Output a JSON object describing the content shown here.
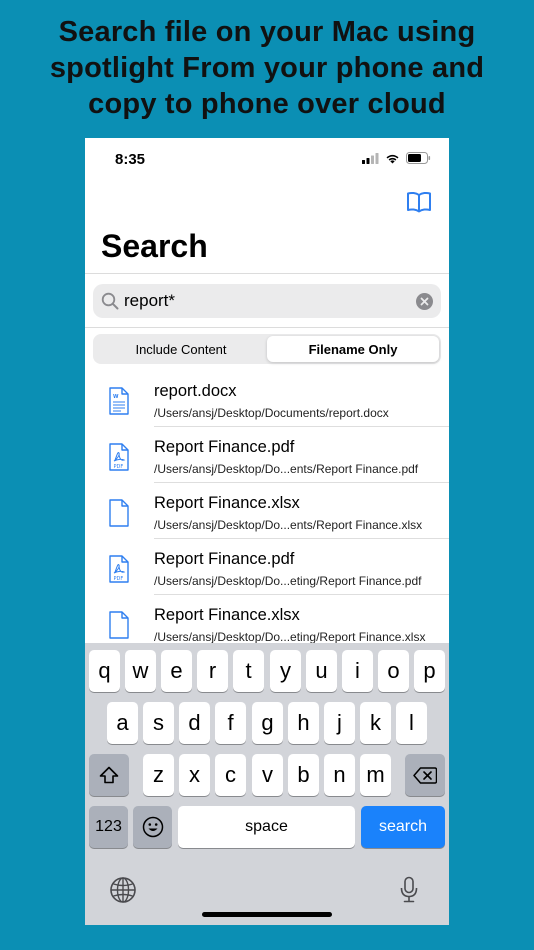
{
  "headline": "Search file on your Mac using spotlight From your phone and copy to phone over cloud",
  "status": {
    "time": "8:35"
  },
  "header": {
    "title": "Search"
  },
  "search": {
    "value": "report*",
    "placeholder": ""
  },
  "segments": [
    {
      "label": "Include Content",
      "active": false
    },
    {
      "label": "Filename Only",
      "active": true
    }
  ],
  "results": [
    {
      "name": "report.docx",
      "path": "/Users/ansj/Desktop/Documents/report.docx",
      "icon": "word-document-icon"
    },
    {
      "name": "Report Finance.pdf",
      "path": "/Users/ansj/Desktop/Do...ents/Report Finance.pdf",
      "icon": "pdf-document-icon"
    },
    {
      "name": "Report Finance.xlsx",
      "path": "/Users/ansj/Desktop/Do...ents/Report Finance.xlsx",
      "icon": "generic-document-icon"
    },
    {
      "name": "Report Finance.pdf",
      "path": "/Users/ansj/Desktop/Do...eting/Report Finance.pdf",
      "icon": "pdf-document-icon"
    },
    {
      "name": "Report Finance.xlsx",
      "path": "/Users/ansj/Desktop/Do...eting/Report Finance.xlsx",
      "icon": "generic-document-icon"
    }
  ],
  "keyboard": {
    "row1": [
      "q",
      "w",
      "e",
      "r",
      "t",
      "y",
      "u",
      "i",
      "o",
      "p"
    ],
    "row2": [
      "a",
      "s",
      "d",
      "f",
      "g",
      "h",
      "j",
      "k",
      "l"
    ],
    "row3": [
      "z",
      "x",
      "c",
      "v",
      "b",
      "n",
      "m"
    ],
    "numbers_label": "123",
    "space_label": "space",
    "search_label": "search"
  },
  "colors": {
    "background": "#0b8fb4",
    "accent": "#1a82fb",
    "icon_blue": "#2f7ff0"
  }
}
